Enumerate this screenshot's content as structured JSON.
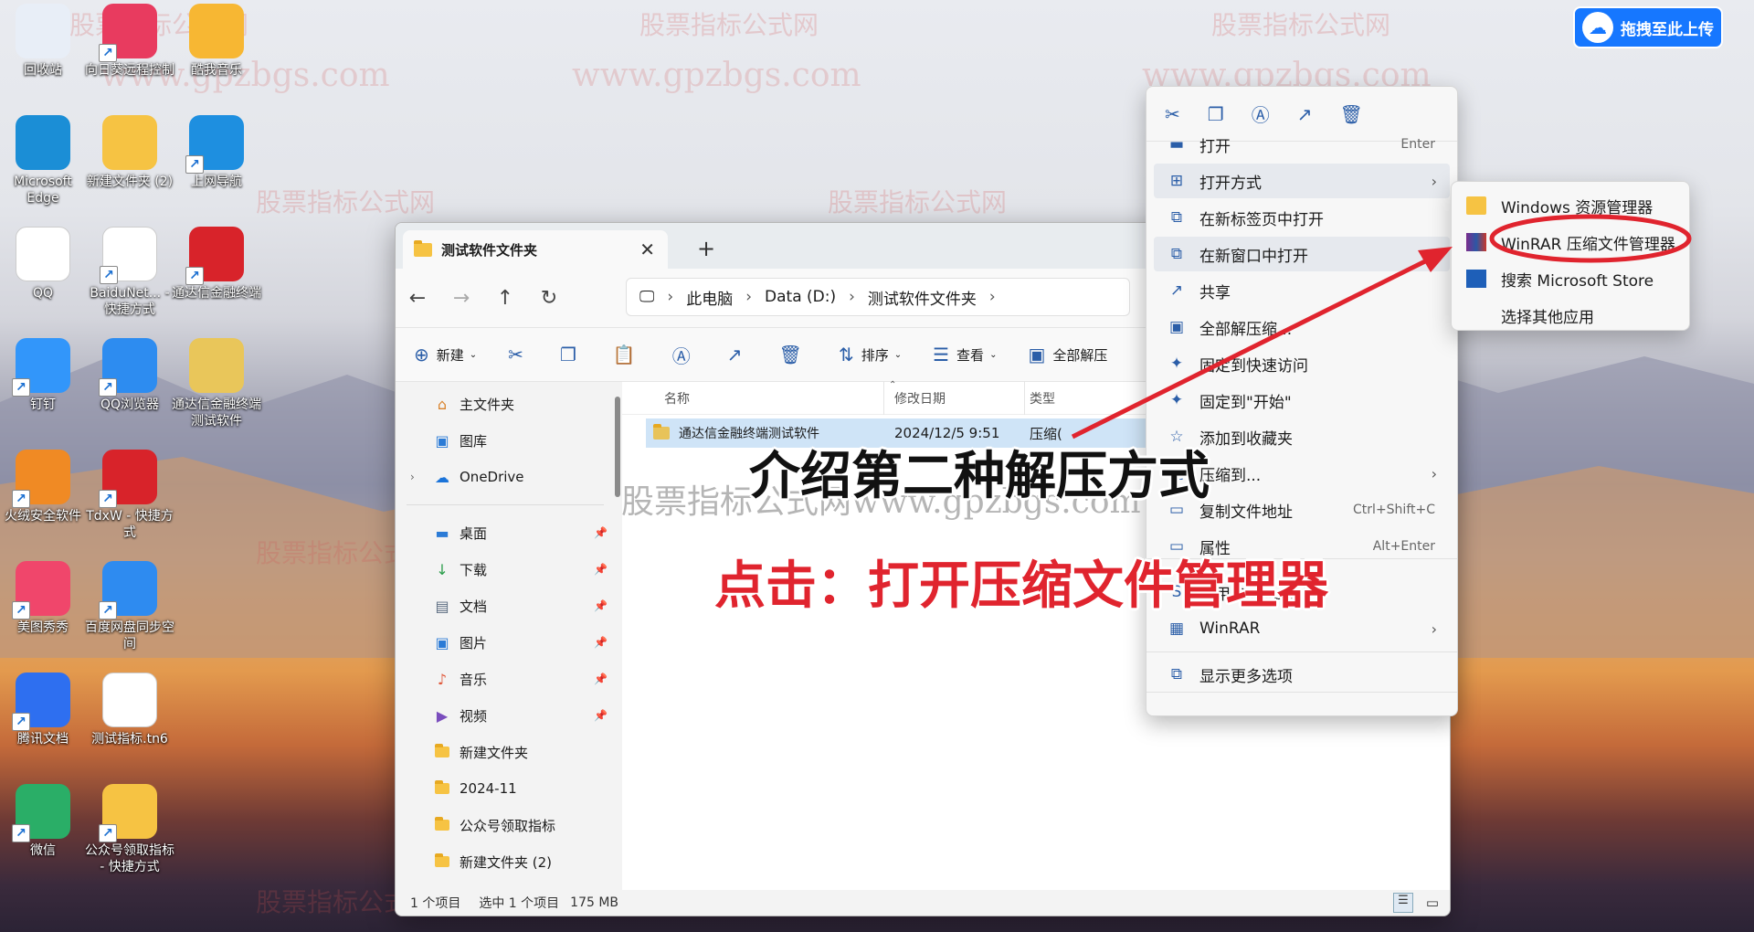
{
  "watermark": {
    "cn": "股票指标公式网",
    "url": "www.gpzbgs.com"
  },
  "upload_button": {
    "label": "拖拽至此上传"
  },
  "desktop_icons": [
    {
      "label": "回收站",
      "color": "#e8eef7"
    },
    {
      "label": "向日葵远程控制",
      "color": "#e83b5f"
    },
    {
      "label": "酷我音乐",
      "color": "#f7b733"
    },
    {
      "label": "Microsoft Edge",
      "color": "#1b8ed6"
    },
    {
      "label": "新建文件夹 (2)",
      "color": "#f6c343"
    },
    {
      "label": "上网导航",
      "color": "#1e8fe0"
    },
    {
      "label": "QQ",
      "color": "#ffffff"
    },
    {
      "label": "BaiduNet... - 快捷方式",
      "color": "#ffffff"
    },
    {
      "label": "通达信金融终端",
      "color": "#d8232a"
    },
    {
      "label": "钉钉",
      "color": "#3296fa"
    },
    {
      "label": "QQ浏览器",
      "color": "#2d8cf0"
    },
    {
      "label": "通达信金融终端测试软件",
      "color": "#e9c65a"
    },
    {
      "label": "火绒安全软件",
      "color": "#f08a24"
    },
    {
      "label": "TdxW - 快捷方式",
      "color": "#d8232a"
    },
    {
      "label": "美图秀秀",
      "color": "#f0466b"
    },
    {
      "label": "百度网盘同步空间",
      "color": "#2e8bf0"
    },
    {
      "label": "腾讯文档",
      "color": "#2e6ff0"
    },
    {
      "label": "测试指标.tn6",
      "color": "#ffffff"
    },
    {
      "label": "微信",
      "color": "#2aae67"
    },
    {
      "label": "公众号领取指标 - 快捷方式",
      "color": "#f6c343"
    }
  ],
  "explorer": {
    "tab_title": "测试软件文件夹",
    "tab_close": "✕",
    "new_tab": "+",
    "breadcrumb": [
      "此电脑",
      "Data (D:)",
      "测试软件文件夹"
    ],
    "toolbar": {
      "new": "新建",
      "sort": "排序",
      "view": "查看",
      "extract_all": "全部解压"
    },
    "sidebar": {
      "home": "主文件夹",
      "gallery": "图库",
      "onedrive": "OneDrive",
      "pinned": [
        "桌面",
        "下载",
        "文档",
        "图片",
        "音乐",
        "视频"
      ],
      "folders": [
        "新建文件夹",
        "2024-11",
        "公众号领取指标",
        "新建文件夹 (2)"
      ]
    },
    "columns": {
      "name": "名称",
      "date": "修改日期",
      "type": "类型"
    },
    "file": {
      "name": "通达信金融终端测试软件",
      "date": "2024/12/5 9:51",
      "type": "压缩("
    },
    "status": {
      "count": "1 个项目",
      "selected": "选中 1 个项目",
      "size": "175 MB"
    }
  },
  "context_menu": {
    "items": [
      {
        "label": "打开",
        "shortcut": "Enter"
      },
      {
        "label": "打开方式",
        "submenu": true
      },
      {
        "label": "在新标签页中打开"
      },
      {
        "label": "在新窗口中打开"
      },
      {
        "label": "共享"
      },
      {
        "label": "全部解压缩..."
      },
      {
        "label": "固定到快速访问"
      },
      {
        "label": "固定到\"开始\""
      },
      {
        "label": "添加到收藏夹"
      },
      {
        "label": "压缩到...",
        "submenu": true
      },
      {
        "label": "复制文件地址",
        "shortcut": "Ctrl+Shift+C"
      },
      {
        "label": "属性",
        "shortcut": "Alt+Enter"
      },
      {
        "label": "使用 Skype 共享"
      },
      {
        "label": "WinRAR",
        "submenu": true
      },
      {
        "label": "显示更多选项"
      }
    ]
  },
  "open_with_submenu": [
    "Windows 资源管理器",
    "WinRAR 压缩文件管理器",
    "搜索 Microsoft Store",
    "选择其他应用"
  ],
  "annotations": {
    "line1": "介绍第二种解压方式",
    "line2": "点击：打开压缩文件管理器",
    "overlay_watermark": "股票指标公式网www.gpzbgs.com"
  }
}
